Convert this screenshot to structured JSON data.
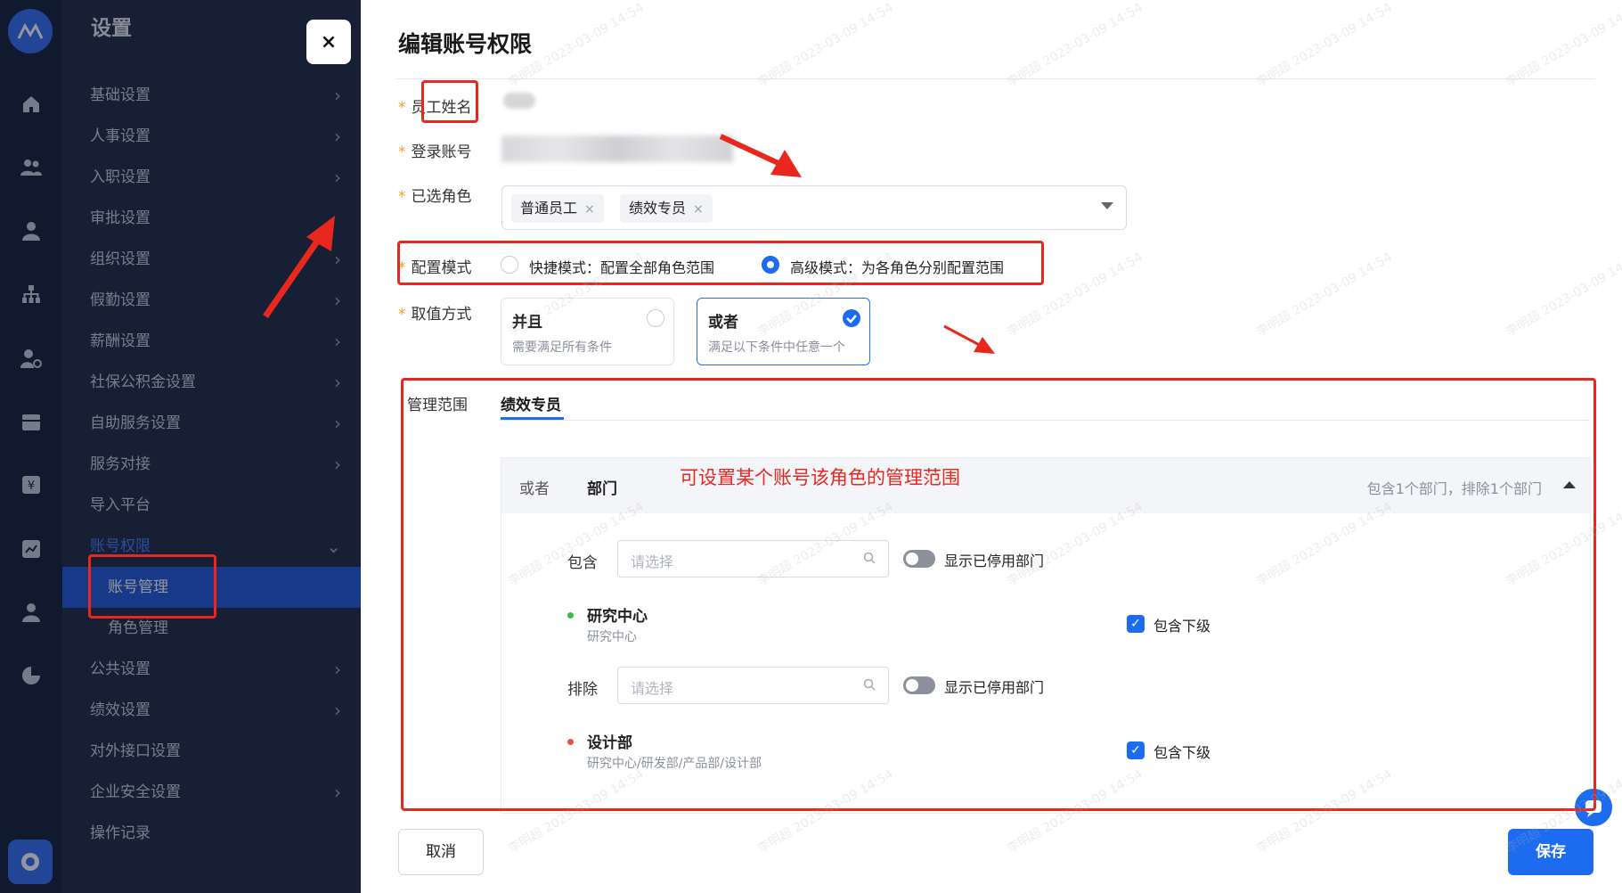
{
  "sidebar": {
    "title": "设置",
    "items": [
      {
        "label": "基础设置",
        "chevron": true
      },
      {
        "label": "人事设置",
        "chevron": true
      },
      {
        "label": "入职设置",
        "chevron": true
      },
      {
        "label": "审批设置",
        "chevron": false
      },
      {
        "label": "组织设置",
        "chevron": true
      },
      {
        "label": "假勤设置",
        "chevron": true
      },
      {
        "label": "薪酬设置",
        "chevron": true
      },
      {
        "label": "社保公积金设置",
        "chevron": true
      },
      {
        "label": "自助服务设置",
        "chevron": true
      },
      {
        "label": "服务对接",
        "chevron": true
      },
      {
        "label": "导入平台",
        "chevron": false
      },
      {
        "label": "账号权限",
        "chevron": true,
        "expanded": true
      },
      {
        "label": "账号管理",
        "sub": true,
        "selected": true
      },
      {
        "label": "角色管理",
        "sub": true
      },
      {
        "label": "公共设置",
        "chevron": true
      },
      {
        "label": "绩效设置",
        "chevron": true
      },
      {
        "label": "对外接口设置",
        "chevron": false
      },
      {
        "label": "企业安全设置",
        "chevron": true
      },
      {
        "label": "操作记录",
        "chevron": false
      }
    ]
  },
  "close_label": "×",
  "drawer": {
    "title": "编辑账号权限",
    "fields": {
      "employee_name": "员工姓名",
      "login_account": "登录账号",
      "selected_roles": "已选角色",
      "config_mode": "配置模式",
      "value_method": "取值方式"
    },
    "roles": [
      "普通员工",
      "绩效专员"
    ],
    "tag_remove": "×",
    "config_mode": {
      "quick": "快捷模式：配置全部角色范围",
      "advanced": "高级模式：为各角色分别配置范围",
      "selected": "advanced"
    },
    "value_method": {
      "and": {
        "title": "并且",
        "desc": "需要满足所有条件"
      },
      "or": {
        "title": "或者",
        "desc": "满足以下条件中任意一个"
      },
      "selected": "or"
    },
    "scope": {
      "label": "管理范围",
      "tab": "绩效专员",
      "head_left": "或者",
      "head_type": "部门",
      "head_summary": "包含1个部门，排除1个部门",
      "include_label": "包含",
      "exclude_label": "排除",
      "placeholder": "请选择",
      "show_disabled": "显示已停用部门",
      "include_item": {
        "name": "研究中心",
        "path": "研究中心",
        "dot_color": "#3cb84a"
      },
      "exclude_item": {
        "name": "设计部",
        "path": "研究中心/研发部/产品部/设计部",
        "dot_color": "#e85050"
      },
      "include_sub": "包含下级",
      "check_mark": "✓"
    },
    "cancel": "取消",
    "save": "保存"
  },
  "annotation": {
    "text": "可设置某个账号该角色的管理范围",
    "color": "#e8281f"
  },
  "watermark": "李明超 2023-03-09 14:54"
}
